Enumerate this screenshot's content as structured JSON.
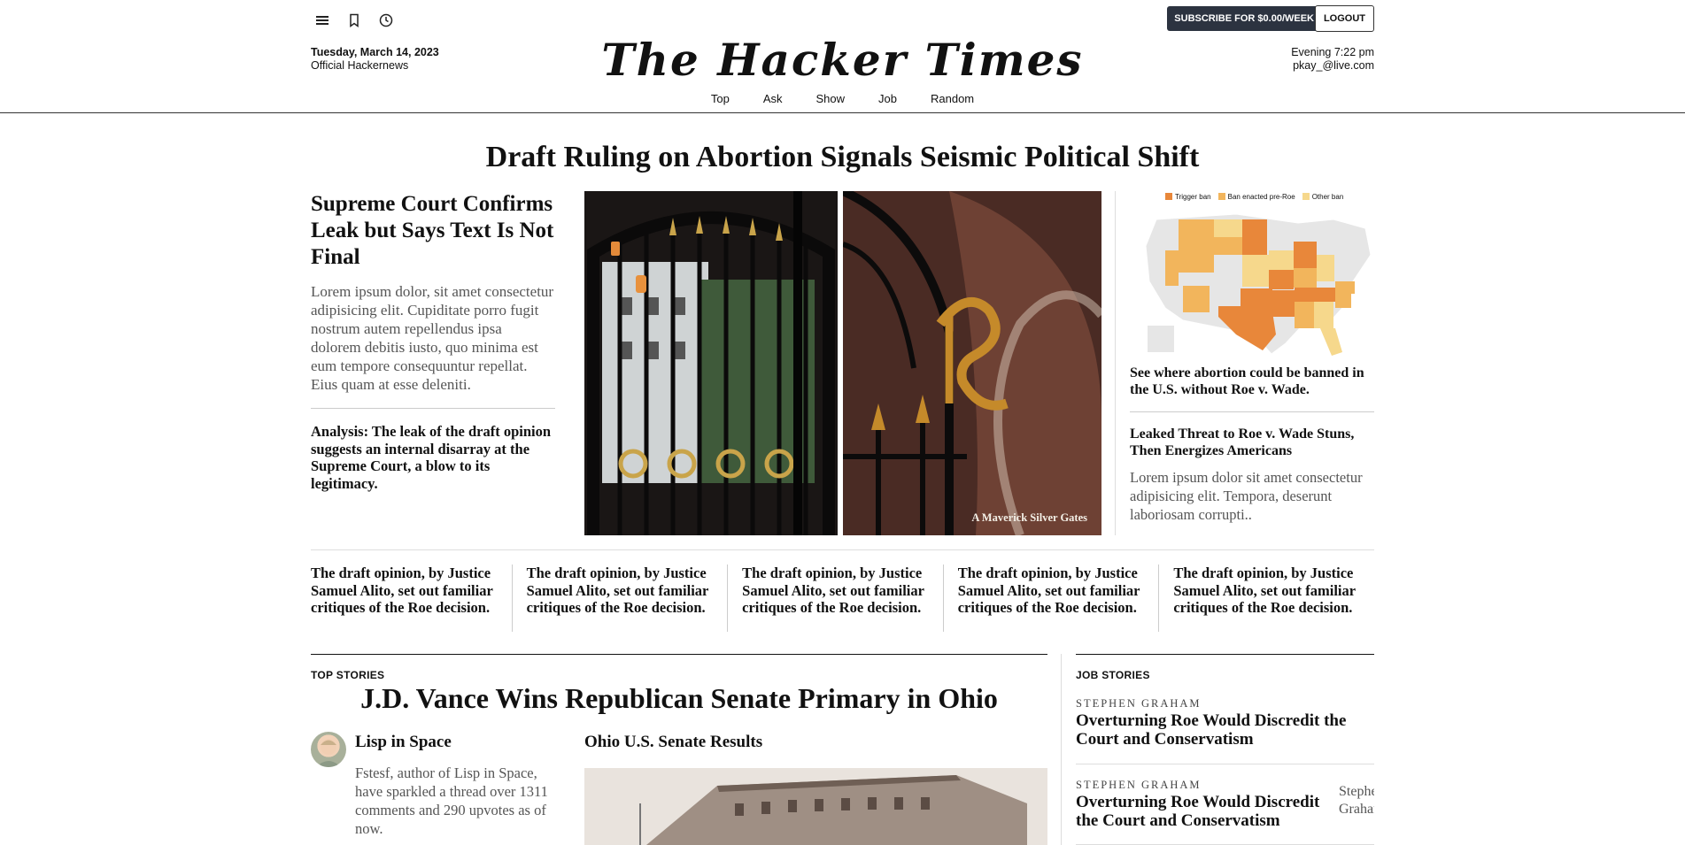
{
  "header": {
    "subscribe_label": "SUBSCRIBE FOR $0.00/WEEK",
    "logout_label": "LOGOUT",
    "date": "Tuesday, March 14, 2023",
    "edition": "Official Hackernews",
    "time": "Evening 7:22 pm",
    "user": "pkay_@live.com",
    "masthead": "The Hacker Times",
    "icons": [
      "menu-icon",
      "bookmark-icon",
      "history-icon"
    ],
    "nav": [
      "Top",
      "Ask",
      "Show",
      "Job",
      "Random"
    ]
  },
  "lead": {
    "title": "Draft Ruling on Abortion Signals Seismic Political Shift",
    "left": {
      "headline": "Supreme Court Confirms Leak but Says Text Is Not Final",
      "body": "Lorem ipsum dolor, sit amet consectetur adipisicing elit. Cupiditate porro fugit nostrum autem repellendus ipsa dolorem debitis iusto, quo minima est eum tempore consequuntur repellat. Eius quam at esse deleniti.",
      "analysis": "Analysis: The leak of the draft opinion suggests an internal disarray at the Supreme Court, a blow to its legitimacy."
    },
    "photo_caption": "A Maverick Silver Gates",
    "right": {
      "legend": [
        "Trigger ban",
        "Ban enacted pre-Roe",
        "Other ban"
      ],
      "legend_colors": [
        "#e8873a",
        "#f2b55c",
        "#f6d88c"
      ],
      "map_caption": "See where abortion could be banned in the U.S. without Roe v. Wade.",
      "headline": "Leaked Threat to Roe v. Wade Stuns, Then Energizes Americans",
      "body": "Lorem ipsum dolor sit amet consectetur adipisicing elit. Tempora, deserunt laboriosam corrupti.."
    }
  },
  "five_items": [
    "The draft opinion, by Justice Samuel Alito, set out familiar critiques of the Roe decision.",
    "The draft opinion, by Justice Samuel Alito, set out familiar critiques of the Roe decision.",
    "The draft opinion, by Justice Samuel Alito, set out familiar critiques of the Roe decision.",
    "The draft opinion, by Justice Samuel Alito, set out familiar critiques of the Roe decision.",
    "The draft opinion, by Justice Samuel Alito, set out familiar critiques of the Roe decision."
  ],
  "top_stories": {
    "label": "TOP STORIES",
    "headline": "J.D. Vance Wins Republican Senate Primary in Ohio",
    "story_title": "Lisp in Space",
    "story_body": "Fstesf, author of Lisp in Space, have sparkled a thread over 1311 comments and 290 upvotes as of now.",
    "results_title": "Ohio U.S. Senate Results"
  },
  "job_stories": {
    "label": "JOB STORIES",
    "items": [
      {
        "author": "Stephen Graham",
        "title": "Overturning Roe Would Discredit the Court and Conservatism"
      },
      {
        "author": "Stephen Graham",
        "title": "Overturning Roe Would Discredit the Court and Conservatism"
      }
    ],
    "overflow": "Stephen Graham"
  }
}
